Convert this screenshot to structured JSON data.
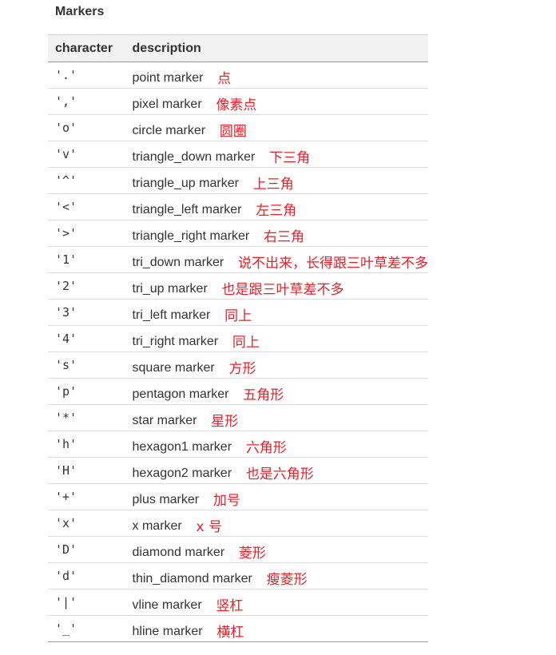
{
  "title": "Markers",
  "headers": {
    "character": "character",
    "description": "description"
  },
  "rows": [
    {
      "character": "'.'",
      "description": "point marker",
      "note": "点"
    },
    {
      "character": "','",
      "description": "pixel marker",
      "note": "像素点"
    },
    {
      "character": "'o'",
      "description": "circle marker",
      "note": "圆圈"
    },
    {
      "character": "'v'",
      "description": "triangle_down marker",
      "note": "下三角"
    },
    {
      "character": "'^'",
      "description": "triangle_up marker",
      "note": "上三角"
    },
    {
      "character": "'<'",
      "description": "triangle_left marker",
      "note": "左三角"
    },
    {
      "character": "'>'",
      "description": "triangle_right marker",
      "note": "右三角"
    },
    {
      "character": "'1'",
      "description": "tri_down marker",
      "note": "说不出来，长得跟三叶草差不多"
    },
    {
      "character": "'2'",
      "description": "tri_up marker",
      "note": "也是跟三叶草差不多"
    },
    {
      "character": "'3'",
      "description": "tri_left marker",
      "note": "同上"
    },
    {
      "character": "'4'",
      "description": "tri_right marker",
      "note": "同上"
    },
    {
      "character": "'s'",
      "description": "square marker",
      "note": "方形"
    },
    {
      "character": "'p'",
      "description": "pentagon marker",
      "note": "五角形"
    },
    {
      "character": "'*'",
      "description": "star marker",
      "note": "星形"
    },
    {
      "character": "'h'",
      "description": "hexagon1 marker",
      "note": "六角形"
    },
    {
      "character": "'H'",
      "description": "hexagon2 marker",
      "note": "也是六角形"
    },
    {
      "character": "'+'",
      "description": "plus marker",
      "note": "加号"
    },
    {
      "character": "'x'",
      "description": "x marker",
      "note": "x 号"
    },
    {
      "character": "'D'",
      "description": "diamond marker",
      "note": "菱形"
    },
    {
      "character": "'d'",
      "description": "thin_diamond marker",
      "note": "瘦菱形"
    },
    {
      "character": "'|'",
      "description": "vline marker",
      "note": "竖杠"
    },
    {
      "character": "'_'",
      "description": "hline marker",
      "note": "横杠"
    }
  ],
  "colors": {
    "text": "#333333",
    "annotation": "#e8202a",
    "header_bg": "#f2f2f2"
  }
}
